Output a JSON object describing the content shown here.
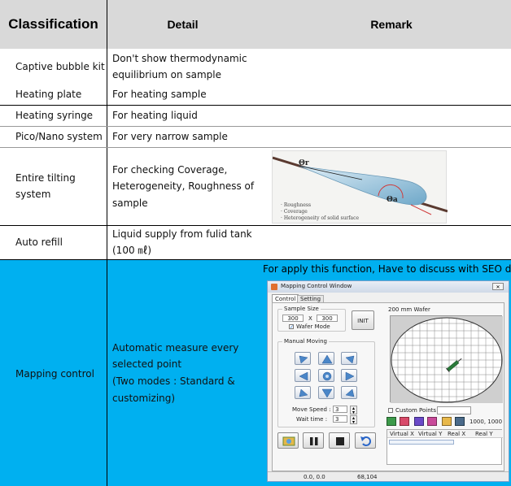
{
  "header": {
    "classification": "Classification",
    "detail": "Detail",
    "remark": "Remark"
  },
  "rows": [
    {
      "label": "Captive bubble kit",
      "detail": [
        "Don't show thermodynamic",
        "equilibrium on sample"
      ]
    },
    {
      "label": "Heating plate",
      "detail": [
        "For heating sample"
      ]
    },
    {
      "label": "Heating syringe",
      "detail": [
        "For heating liquid"
      ]
    },
    {
      "label": "Pico/Nano system",
      "detail": [
        "For very narrow sample"
      ]
    },
    {
      "label": [
        "Entire tilting",
        "system"
      ],
      "detail": [
        "For checking Coverage,",
        "Heterogeneity, Roughness of",
        "sample"
      ]
    },
    {
      "label": "Auto refill",
      "detail": [
        "Liquid supply from fulid tank",
        "(100 ㎖)"
      ]
    },
    {
      "label": "Mapping control",
      "detail": [
        "Automatic measure every",
        "selected point",
        "(Two modes : Standard &",
        "customizing)"
      ]
    }
  ],
  "tilt_image": {
    "theta_r": "Θr",
    "theta_a": "Θa",
    "notes": [
      "· Roughness",
      "· Coverage",
      "· Heterogeneity of solid surface"
    ]
  },
  "mapping": {
    "remark": "For apply this function, Have to discuss with SEO detail",
    "window_title": "Mapping Control Window",
    "tabs": [
      "Control",
      "Setting"
    ],
    "sample_size_label": "Sample Size",
    "size_w": "300",
    "size_x": "X",
    "size_h": "300",
    "wafer_mode": "Wafer Mode",
    "init_label": "INIT",
    "wafer_title": "200 mm Wafer",
    "manual_moving": "Manual Moving",
    "move_speed_label": "Move Speed :",
    "move_speed": "3",
    "wait_time_label": "Wait time :",
    "wait_time": "3",
    "custom_points": "Custom Points",
    "coords": "1000, 1000",
    "columns": [
      "Virtual X",
      "Virtual Y",
      "Real X",
      "Real Y"
    ],
    "status_pos": "0.0, 0.0",
    "status_val": "68,104"
  }
}
